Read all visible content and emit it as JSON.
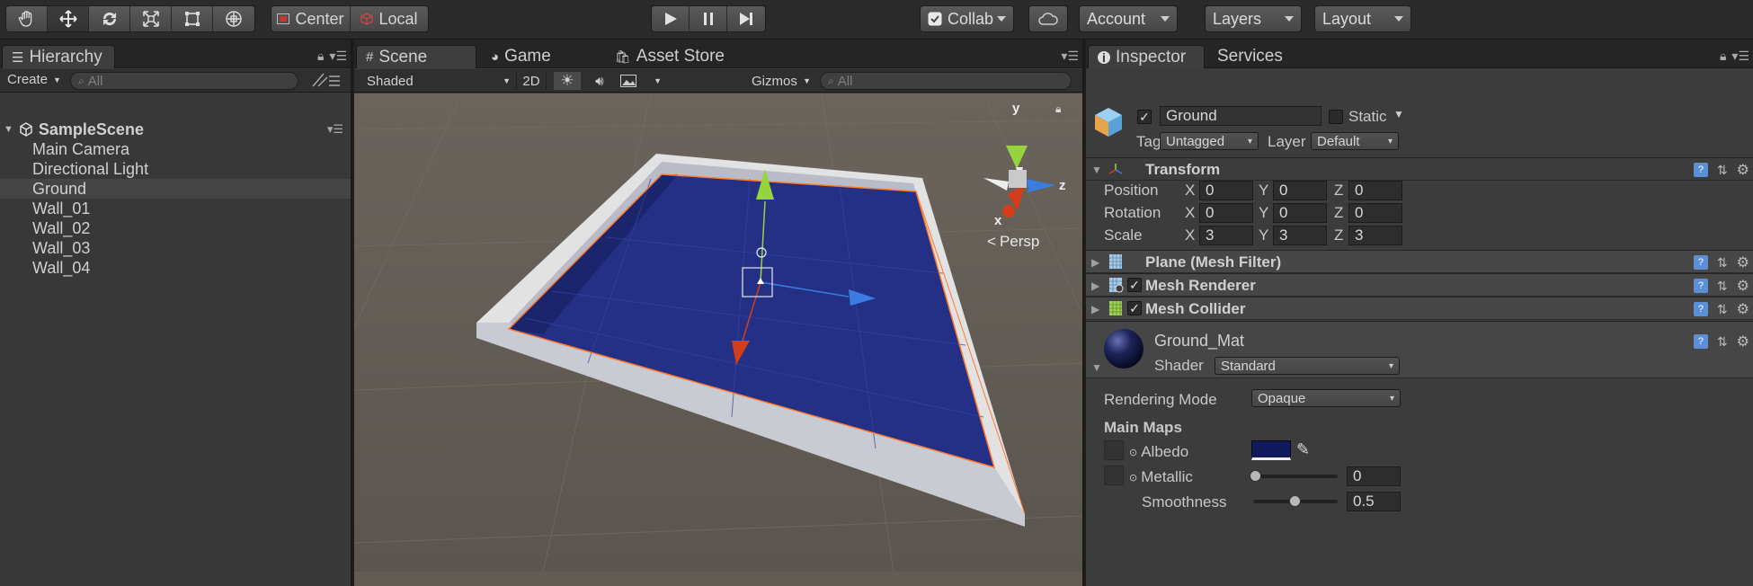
{
  "toolbar": {
    "pivot_mode": "Center",
    "pivot_rotation": "Local",
    "collab": "Collab",
    "account": "Account",
    "layers": "Layers",
    "layout": "Layout"
  },
  "hierarchy": {
    "tab_label": "Hierarchy",
    "create_label": "Create",
    "search_placeholder": "All",
    "scene_name": "SampleScene",
    "items": [
      "Main Camera",
      "Directional Light",
      "Ground",
      "Wall_01",
      "Wall_02",
      "Wall_03",
      "Wall_04"
    ],
    "selected_item": "Ground"
  },
  "scene_view": {
    "tabs": [
      "Scene",
      "Game",
      "Asset Store"
    ],
    "active_tab": "Scene",
    "draw_mode": "Shaded",
    "mode_2d": "2D",
    "gizmos": "Gizmos",
    "search_placeholder": "All",
    "axis_x": "x",
    "axis_y": "y",
    "axis_z": "z",
    "projection": "Persp",
    "colors": {
      "ground": "#243085",
      "walls": "#dcdcdc",
      "background": "#625c55",
      "axis_x": "#d43d1a",
      "axis_y": "#95d43b",
      "axis_z": "#3a7de0",
      "selection_outline": "#ff7a2a"
    }
  },
  "inspector": {
    "tabs": [
      "Inspector",
      "Services"
    ],
    "active_tab": "Inspector",
    "object_name": "Ground",
    "active": true,
    "static_label": "Static",
    "static": false,
    "tag_label": "Tag",
    "tag": "Untagged",
    "layer_label": "Layer",
    "layer": "Default",
    "transform": {
      "title": "Transform",
      "rows": [
        {
          "label": "Position",
          "x": "0",
          "y": "0",
          "z": "0"
        },
        {
          "label": "Rotation",
          "x": "0",
          "y": "0",
          "z": "0"
        },
        {
          "label": "Scale",
          "x": "3",
          "y": "3",
          "z": "3"
        }
      ]
    },
    "components": [
      {
        "name": "Plane (Mesh Filter)",
        "has_checkbox": false
      },
      {
        "name": "Mesh Renderer",
        "has_checkbox": true
      },
      {
        "name": "Mesh Collider",
        "has_checkbox": true
      }
    ],
    "material": {
      "name": "Ground_Mat",
      "shader_label": "Shader",
      "shader": "Standard",
      "rendering_mode_label": "Rendering Mode",
      "rendering_mode": "Opaque",
      "main_maps_label": "Main Maps",
      "albedo_label": "Albedo",
      "albedo_color": "#111a5c",
      "metallic_label": "Metallic",
      "metallic": "0",
      "smoothness_label": "Smoothness",
      "smoothness": "0.5"
    }
  }
}
